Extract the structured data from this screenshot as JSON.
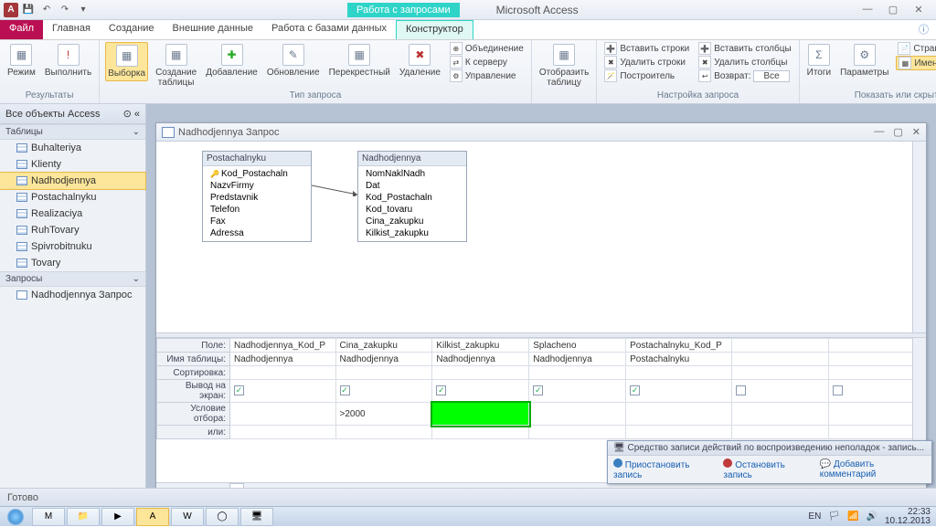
{
  "app": {
    "title": "Microsoft Access",
    "context_tab": "Работа с запросами"
  },
  "tabs": {
    "file": "Файл",
    "home": "Главная",
    "create": "Создание",
    "external": "Внешние данные",
    "dbtools": "Работа с базами данных",
    "design": "Конструктор"
  },
  "ribbon": {
    "groups": {
      "results": {
        "label": "Результаты",
        "view": "Режим",
        "run": "Выполнить"
      },
      "querytype": {
        "label": "Тип запроса",
        "select": "Выборка",
        "maketable": "Создание\nтаблицы",
        "append": "Добавление",
        "update": "Обновление",
        "crosstab": "Перекрестный",
        "delete": "Удаление",
        "union": "Объединение",
        "passthrough": "К серверу",
        "datadef": "Управление"
      },
      "showtbl": {
        "label": "",
        "show": "Отобразить\nтаблицу"
      },
      "querysetup": {
        "label": "Настройка запроса",
        "insrows": "Вставить строки",
        "delrows": "Удалить строки",
        "builder": "Построитель",
        "inscols": "Вставить столбцы",
        "delcols": "Удалить столбцы",
        "return": "Возврат:",
        "return_val": "Все"
      },
      "showhide": {
        "label": "Показать или скрыть",
        "totals": "Итоги",
        "params": "Параметры",
        "propsheet": "Страница свойств",
        "tablenames": "Имена таблиц"
      }
    }
  },
  "nav": {
    "header": "Все объекты Access",
    "sections": {
      "tables": "Таблицы",
      "queries": "Запросы"
    },
    "tables": [
      "Buhalteriya",
      "Klienty",
      "Nadhodjennya",
      "Postachalnyku",
      "Realizaciya",
      "RuhTovary",
      "Spivrobitnuku",
      "Tovary"
    ],
    "queries": [
      "Nadhodjennya Запрос"
    ]
  },
  "query": {
    "title": "Nadhodjennya Запрос",
    "tables": {
      "post": {
        "name": "Postachalnyku",
        "fields": [
          "Kod_Postachaln",
          "NazvFirmy",
          "Predstavnik",
          "Telefon",
          "Fax",
          "Adressa"
        ]
      },
      "nad": {
        "name": "Nadhodjennya",
        "fields": [
          "NomNaklNadh",
          "Dat",
          "Kod_Postachaln",
          "Kod_tovaru",
          "Cina_zakupku",
          "Kilkist_zakupku"
        ]
      }
    },
    "grid": {
      "rows": {
        "field": "Поле:",
        "table": "Имя таблицы:",
        "sort": "Сортировка:",
        "show": "Вывод на экран:",
        "criteria": "Условие отбора:",
        "or": "или:"
      },
      "cols": [
        {
          "field": "Nadhodjennya_Kod_P",
          "table": "Nadhodjennya",
          "show": true,
          "criteria": ""
        },
        {
          "field": "Cina_zakupku",
          "table": "Nadhodjennya",
          "show": true,
          "criteria": ">2000"
        },
        {
          "field": "Kilkist_zakupku",
          "table": "Nadhodjennya",
          "show": true,
          "criteria": ""
        },
        {
          "field": "Splacheno",
          "table": "Nadhodjennya",
          "show": true,
          "criteria": ""
        },
        {
          "field": "Postachalnyku_Kod_P",
          "table": "Postachalnyku",
          "show": true,
          "criteria": ""
        },
        {
          "field": "",
          "table": "",
          "show": false,
          "criteria": ""
        },
        {
          "field": "",
          "table": "",
          "show": false,
          "criteria": ""
        }
      ]
    }
  },
  "psr": {
    "title": "Средство записи действий по воспроизведению неполадок - запись...",
    "pause": "Приостановить запись",
    "stop": "Остановить запись",
    "comment": "Добавить комментарий"
  },
  "status": {
    "ready": "Готово"
  },
  "tray": {
    "lang": "EN",
    "time": "22:33",
    "date": "10.12.2013"
  }
}
